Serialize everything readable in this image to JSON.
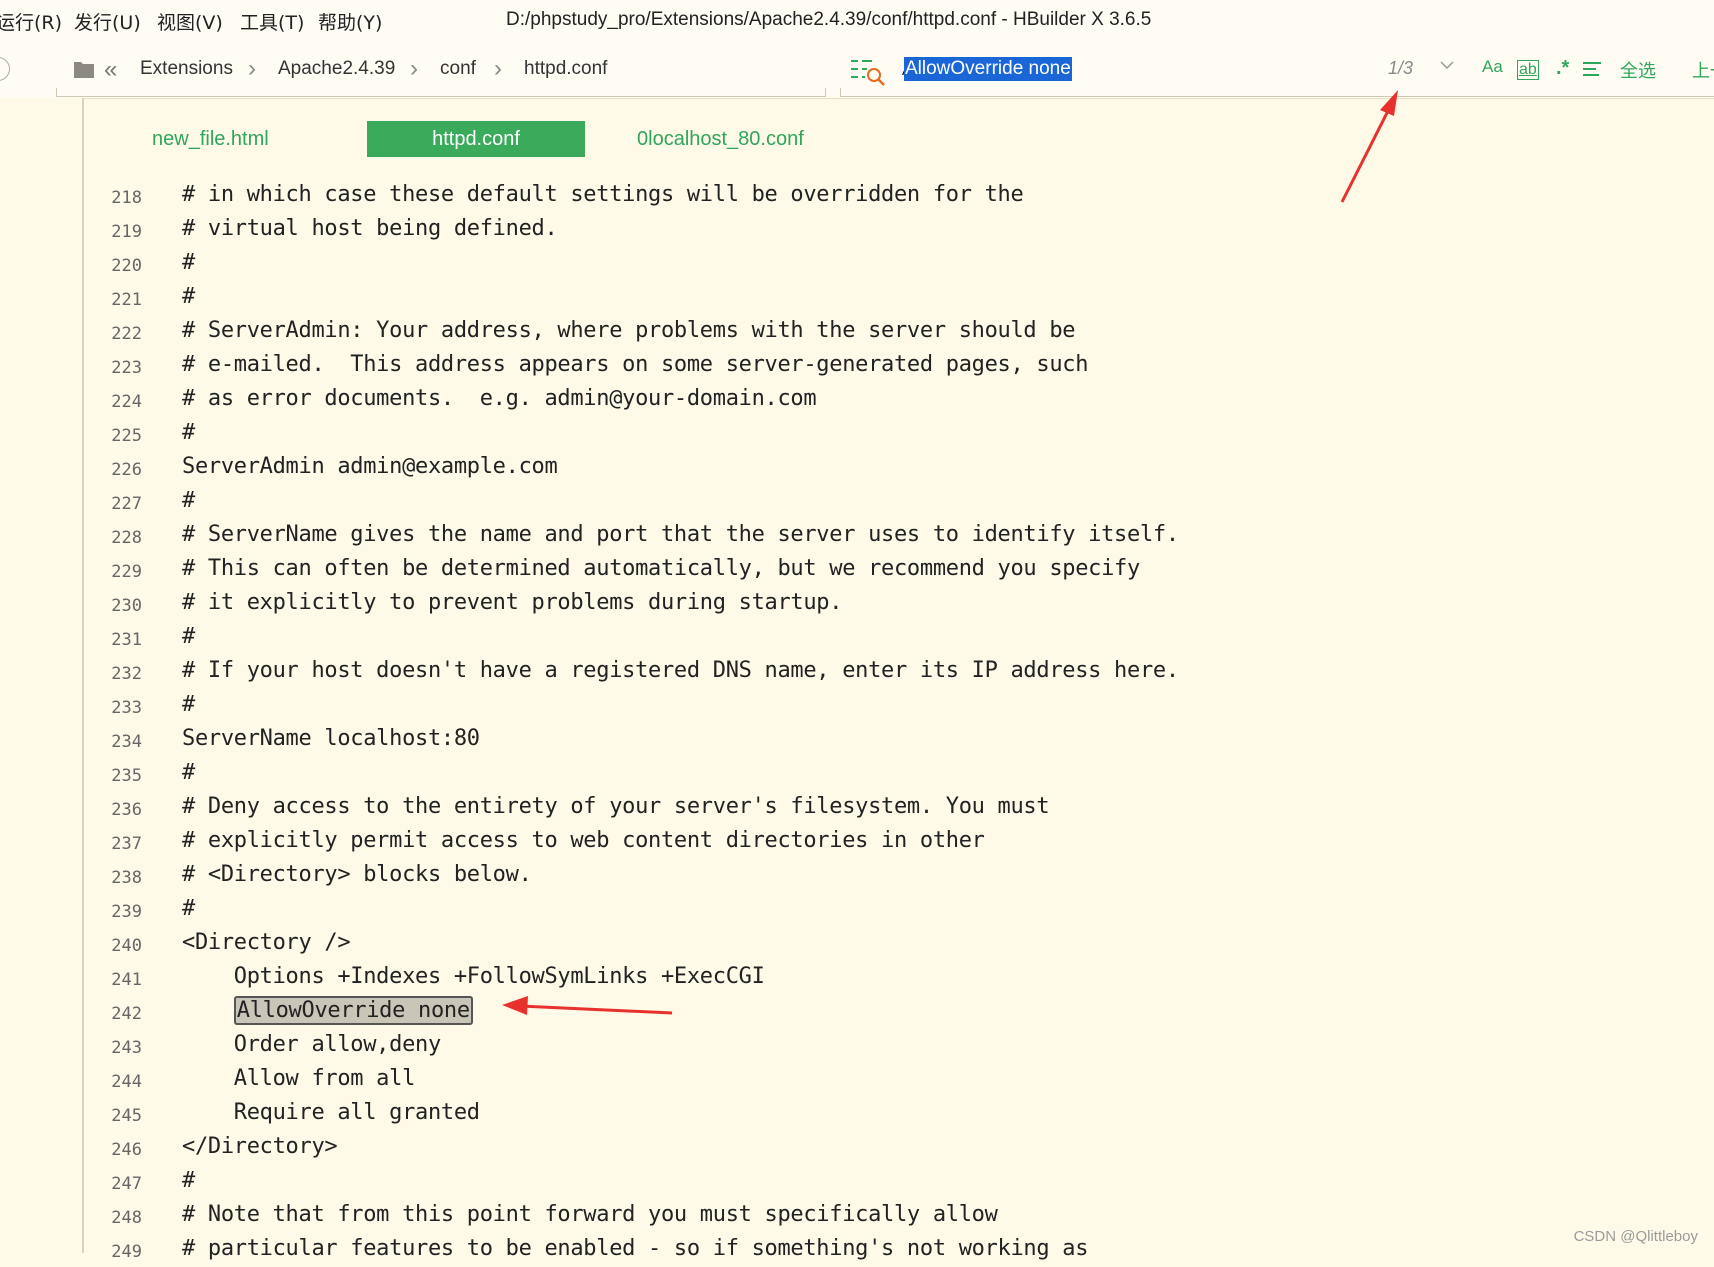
{
  "menu": {
    "items": [
      "运行(R)",
      "发行(U)",
      "视图(V)",
      "工具(T)",
      "帮助(Y)"
    ]
  },
  "window_title": "D:/phpstudy_pro/Extensions/Apache2.4.39/conf/httpd.conf - HBuilder X 3.6.5",
  "breadcrumb": {
    "items": [
      "Extensions",
      "Apache2.4.39",
      "conf",
      "httpd.conf"
    ]
  },
  "find": {
    "value": "AllowOverride none",
    "match_count": "1/3",
    "case_label": "Aa",
    "word_label": "ab",
    "regex_label": ".*",
    "select_all_label": "全选",
    "prev_label": "上一"
  },
  "tabs": [
    {
      "label": "new_file.html",
      "active": false
    },
    {
      "label": "httpd.conf",
      "active": true
    },
    {
      "label": "0localhost_80.conf",
      "active": false
    }
  ],
  "code_lines": [
    {
      "n": "218",
      "t": "# in which case these default settings will be overridden for the"
    },
    {
      "n": "219",
      "t": "# virtual host being defined."
    },
    {
      "n": "220",
      "t": "#"
    },
    {
      "n": "221",
      "t": "#"
    },
    {
      "n": "222",
      "t": "# ServerAdmin: Your address, where problems with the server should be"
    },
    {
      "n": "223",
      "t": "# e-mailed.  This address appears on some server-generated pages, such"
    },
    {
      "n": "224",
      "t": "# as error documents.  e.g. admin@your-domain.com"
    },
    {
      "n": "225",
      "t": "#"
    },
    {
      "n": "226",
      "t": "ServerAdmin admin@example.com"
    },
    {
      "n": "227",
      "t": "#"
    },
    {
      "n": "228",
      "t": "# ServerName gives the name and port that the server uses to identify itself."
    },
    {
      "n": "229",
      "t": "# This can often be determined automatically, but we recommend you specify"
    },
    {
      "n": "230",
      "t": "# it explicitly to prevent problems during startup."
    },
    {
      "n": "231",
      "t": "#"
    },
    {
      "n": "232",
      "t": "# If your host doesn't have a registered DNS name, enter its IP address here."
    },
    {
      "n": "233",
      "t": "#"
    },
    {
      "n": "234",
      "t": "ServerName localhost:80"
    },
    {
      "n": "235",
      "t": "#"
    },
    {
      "n": "236",
      "t": "# Deny access to the entirety of your server's filesystem. You must"
    },
    {
      "n": "237",
      "t": "# explicitly permit access to web content directories in other"
    },
    {
      "n": "238",
      "t": "# <Directory> blocks below."
    },
    {
      "n": "239",
      "t": "#"
    },
    {
      "n": "240",
      "t": "<Directory />"
    },
    {
      "n": "241",
      "t": "    Options +Indexes +FollowSymLinks +ExecCGI"
    },
    {
      "n": "242",
      "t": "    ",
      "hl": "AllowOverride none"
    },
    {
      "n": "243",
      "t": "    Order allow,deny"
    },
    {
      "n": "244",
      "t": "    Allow from all"
    },
    {
      "n": "245",
      "t": "    Require all granted"
    },
    {
      "n": "246",
      "t": "</Directory>"
    },
    {
      "n": "247",
      "t": "#"
    },
    {
      "n": "248",
      "t": "# Note that from this point forward you must specifically allow"
    },
    {
      "n": "249",
      "t": "# particular features to be enabled - so if something's not working as"
    }
  ],
  "watermark": "CSDN @Qlittleboy",
  "colors": {
    "background": "#fffae8",
    "accent_green": "#3aaa5b",
    "find_highlight": "#1a66d6",
    "annotation_arrow": "#e8302c"
  }
}
